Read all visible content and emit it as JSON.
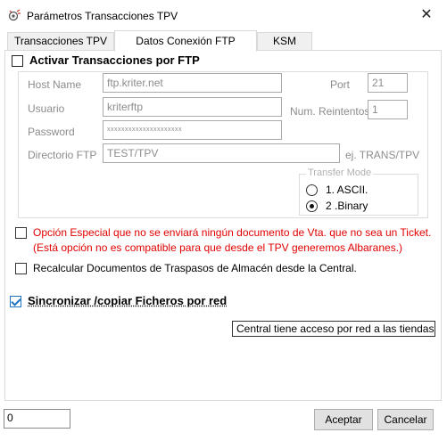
{
  "window": {
    "title": "Parámetros Transacciones TPV",
    "close_glyph": "✕"
  },
  "tabs": [
    {
      "label": "Transacciones TPV"
    },
    {
      "label": "Datos Conexión FTP"
    },
    {
      "label": "KSM"
    }
  ],
  "ftp": {
    "activate_label": "Activar Transacciones por FTP",
    "host_label": "Host Name",
    "host_value": "ftp.kriter.net",
    "port_label": "Port",
    "port_value": "21",
    "user_label": "Usuario",
    "user_value": "kriterftp",
    "retries_label": "Num. Reintentos",
    "retries_value": "1",
    "password_label": "Password",
    "password_value": "xxxxxxxxxxxxxxxxxxxxx",
    "dir_label": "Directorio FTP",
    "dir_value": "TEST/TPV",
    "dir_hint": "ej. TRANS/TPV",
    "transfer_mode": {
      "title": "Transfer Mode",
      "ascii_label": "1. ASCII.",
      "binary_label": "2 .Binary",
      "selected": "binary"
    }
  },
  "options": {
    "special_line1": "Opción Especial que no se enviará ningún documento de Vta. que no sea un Ticket.",
    "special_line2": "(Está opción no es compatible para que desde el TPV generemos Albaranes.)",
    "recalc_label": "Recalcular Documentos de Traspasos de Almacén desde la Central.",
    "sync_label": "Sincronizar /copiar Ficheros por red",
    "sync_tooltip": "Central tiene acceso por red a las tiendas para sincronizar las bandejas"
  },
  "footer": {
    "status_value": "0",
    "accept_label": "Aceptar",
    "cancel_label": "Cancelar"
  }
}
